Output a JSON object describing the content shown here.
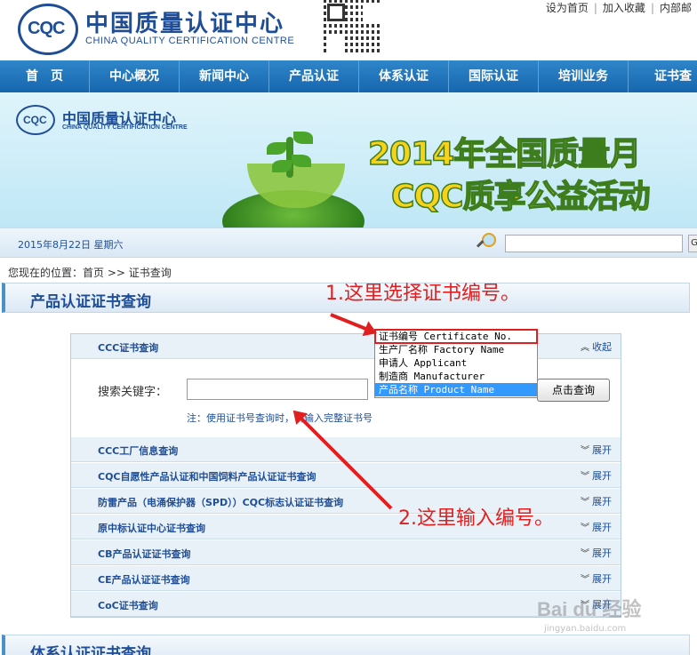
{
  "header": {
    "logo_mark": "CQC",
    "logo_cn": "中国质量认证中心",
    "logo_en": "CHINA QUALITY CERTIFICATION CENTRE",
    "top_links": [
      "设为首页",
      "加入收藏",
      "内部邮"
    ]
  },
  "nav": {
    "items": [
      "首　页",
      "中心概况",
      "新闻中心",
      "产品认证",
      "体系认证",
      "国际认证",
      "培训业务",
      "证书查"
    ]
  },
  "banner": {
    "logo_mark": "CQC",
    "logo_cn": "中国质量认证中心",
    "logo_en": "CHINA QUALITY CERTIFICATION CENTRE",
    "line1": "2014年全国质量月",
    "line2": "CQC质享公益活动"
  },
  "datebar": {
    "date": "2015年8月22日  星期六",
    "search_button": "G"
  },
  "breadcrumb": "您现在的位置：首页 >> 证书查询",
  "section_product": "产品认证证书查询",
  "section_system": "体系认证证书查询",
  "panel": {
    "ccc_title": "CCC证书查询",
    "ccc_action": "收起",
    "keyword_label": "搜索关键字：",
    "search_button": "点击查询",
    "note": "注：使用证书号查询时，请输入完整证书号",
    "rows": [
      {
        "title": "CCC工厂信息查询",
        "action": "展开"
      },
      {
        "title": "CQC自愿性产品认证和中国饲料产品认证证书查询",
        "action": "展开"
      },
      {
        "title": "防雷产品（电涌保护器（SPD））CQC标志认证证书查询",
        "action": "展开"
      },
      {
        "title": "原中标认证中心证书查询",
        "action": "展开"
      },
      {
        "title": "CB产品认证证书查询",
        "action": "展开"
      },
      {
        "title": "CE产品认证证书查询",
        "action": "展开"
      },
      {
        "title": "CoC证书查询",
        "action": "展开"
      }
    ]
  },
  "dropdown": {
    "options": [
      "证书编号 Certificate No.",
      "生产厂名称 Factory Name",
      "申请人 Applicant",
      "制造商 Manufacturer",
      "产品名称 Product Name"
    ],
    "selected_index": 4,
    "highlighted_index": 0
  },
  "annotations": {
    "step1": "1.这里选择证书编号。",
    "step2": "2.这里输入编号。",
    "color": "#e02020"
  },
  "watermark": {
    "brand": "Bai du 经验",
    "url": "jingyan.baidu.com"
  },
  "colors": {
    "brand_blue": "#1f4e96",
    "nav_blue": "#1766ad",
    "select_blue": "#3399ff",
    "banner_yellow": "#f6d21a"
  }
}
